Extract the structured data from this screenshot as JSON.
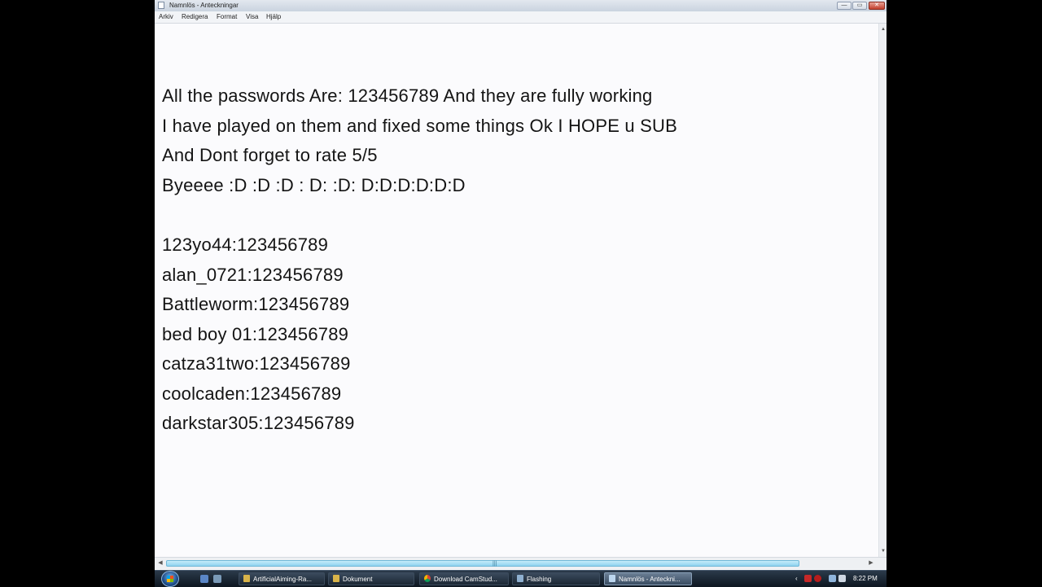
{
  "window": {
    "title": "Namnlös - Anteckningar",
    "controls": {
      "minimize": "—",
      "maximize": "▭",
      "close": "✕"
    }
  },
  "menu": [
    "Arkiv",
    "Redigera",
    "Format",
    "Visa",
    "Hjälp"
  ],
  "editor": {
    "lines": [
      "All the passwords Are: 123456789 And they are fully working",
      "I have played on them and fixed some things Ok I HOPE u SUB",
      "And Dont forget to rate 5/5",
      "Byeeee :D :D :D : D: :D: D:D:D:D:D:D",
      "",
      "123yo44:123456789",
      "alan_0721:123456789",
      "Battleworm:123456789",
      "bed boy 01:123456789",
      "catza31two:123456789",
      "coolcaden:123456789",
      "darkstar305:123456789"
    ]
  },
  "scrollbars": {
    "up": "▲",
    "down": "▼",
    "left": "◀",
    "right": "▶",
    "grip": "|||"
  },
  "taskbar": {
    "tasks": [
      {
        "label": "ArtificialAiming-Ra...",
        "icon": "folder-icon",
        "color": "#d9b44a"
      },
      {
        "label": "Dokument",
        "icon": "folder-icon",
        "color": "#d9b44a"
      },
      {
        "label": "Download CamStud...",
        "icon": "chrome-icon",
        "color": "#4caf50"
      },
      {
        "label": "Flashing",
        "icon": "folder-icon",
        "color": "#8fb0d0"
      },
      {
        "label": "Namnlös - Anteckni...",
        "icon": "notepad-icon",
        "color": "#bcd6ee"
      }
    ],
    "tray": {
      "expand": "‹",
      "time": "8:22 PM"
    }
  }
}
